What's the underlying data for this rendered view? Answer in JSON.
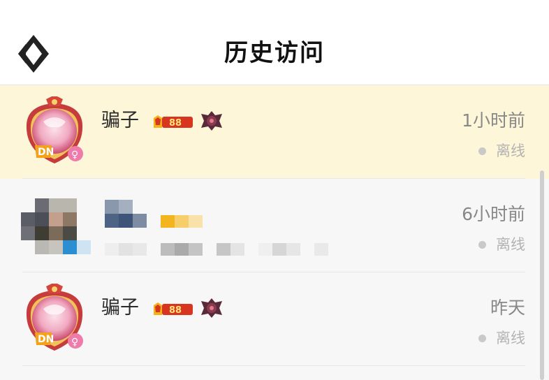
{
  "header": {
    "title": "历史访问"
  },
  "visitors": [
    {
      "name": "骗子",
      "vip_level": "88",
      "time": "1小时前",
      "status": "离线"
    },
    {
      "name": "",
      "time": "6小时前",
      "status": "离线"
    },
    {
      "name": "骗子",
      "vip_level": "88",
      "time": "昨天",
      "status": "离线"
    }
  ],
  "colors": {
    "header_bg": "#ffffff",
    "highlight_row": "#fdf6d8",
    "list_bg": "#f7f7f7",
    "offline_dot": "#c9c9c9",
    "badge_red": "#d7351f",
    "badge_gold": "#f3b21a"
  }
}
